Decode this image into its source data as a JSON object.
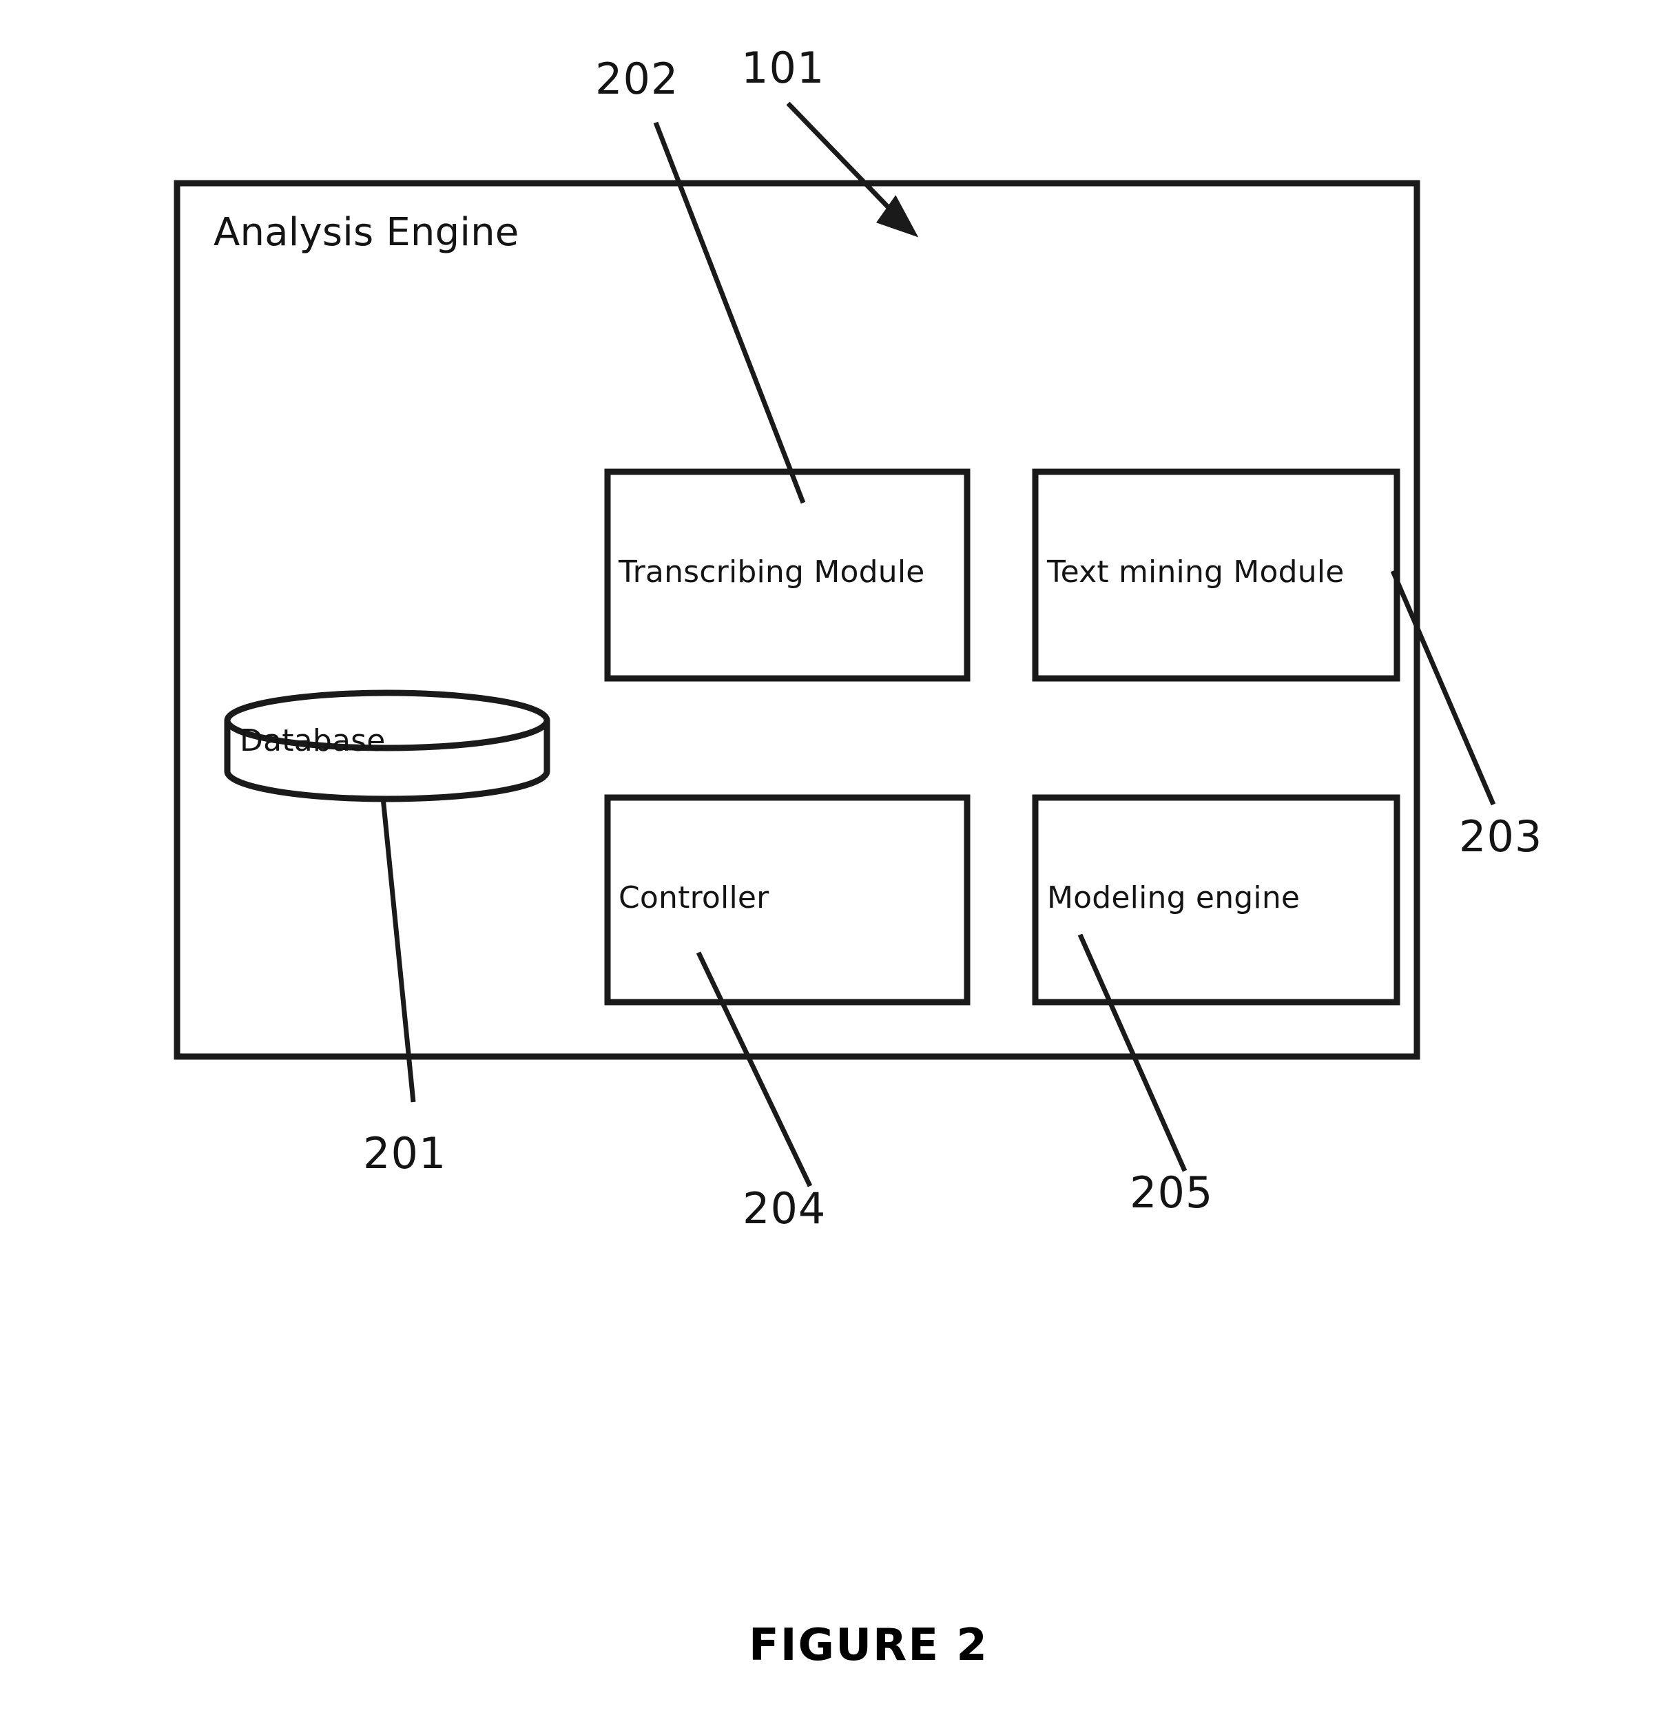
{
  "figure": {
    "caption": "FIGURE 2",
    "container_label": "Analysis Engine",
    "container_ref": "101"
  },
  "nodes": [
    {
      "id": "database",
      "label": "Database",
      "ref": "201",
      "shape": "cylinder"
    },
    {
      "id": "transcribing-module",
      "label": "Transcribing Module",
      "ref": "202",
      "shape": "rectangle"
    },
    {
      "id": "text-mining-module",
      "label": "Text mining Module",
      "ref": "203",
      "shape": "rectangle"
    },
    {
      "id": "controller",
      "label": "Controller",
      "ref": "204",
      "shape": "rectangle"
    },
    {
      "id": "modeling-engine",
      "label": "Modeling engine",
      "ref": "205",
      "shape": "rectangle"
    }
  ],
  "reference_numerals": {
    "container": "101",
    "database": "201",
    "transcribing_module": "202",
    "text_mining_module": "203",
    "controller": "204",
    "modeling_engine": "205"
  },
  "colors": {
    "stroke": "#1a1a1a",
    "background": "#ffffff",
    "text": "#141414"
  }
}
